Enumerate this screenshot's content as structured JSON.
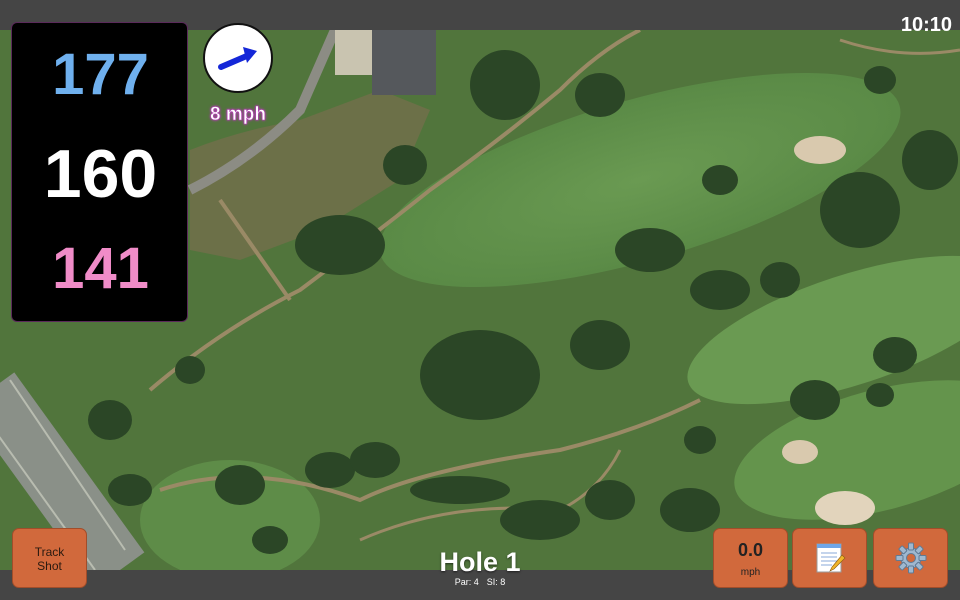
{
  "status_bar": {
    "time": "10:10"
  },
  "distances": {
    "back": "177",
    "middle": "160",
    "front": "141"
  },
  "wind": {
    "direction_icon": "arrow-right-icon",
    "speed_label": "8 mph"
  },
  "hole": {
    "title": "Hole 1",
    "par_label": "Par: 4",
    "si_label": "SI: 8"
  },
  "buttons": {
    "track_shot_line1": "Track",
    "track_shot_line2": "Shot",
    "wind_value": "0.0",
    "wind_unit": "mph",
    "notes_icon": "notepad-icon",
    "settings_icon": "gear-icon"
  },
  "colors": {
    "back_distance": "#6fb0ee",
    "middle_distance": "#ffffff",
    "front_distance": "#f08cc8",
    "button_bg": "#d1693c",
    "wind_label_outline": "#b03eb0"
  }
}
